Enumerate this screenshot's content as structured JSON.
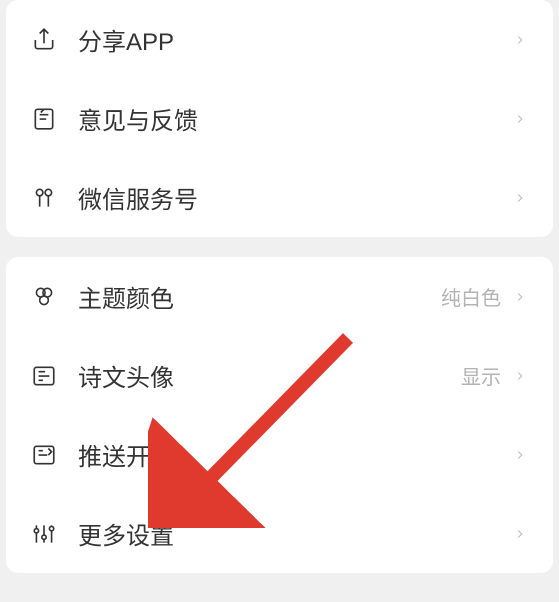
{
  "groups": [
    {
      "items": [
        {
          "icon": "share",
          "label": "分享APP",
          "value": ""
        },
        {
          "icon": "feedback",
          "label": "意见与反馈",
          "value": ""
        },
        {
          "icon": "wechat",
          "label": "微信服务号",
          "value": ""
        }
      ]
    },
    {
      "items": [
        {
          "icon": "theme",
          "label": "主题颜色",
          "value": "纯白色"
        },
        {
          "icon": "avatar",
          "label": "诗文头像",
          "value": "显示"
        },
        {
          "icon": "push",
          "label": "推送开启",
          "value": ""
        },
        {
          "icon": "settings",
          "label": "更多设置",
          "value": ""
        }
      ]
    }
  ]
}
